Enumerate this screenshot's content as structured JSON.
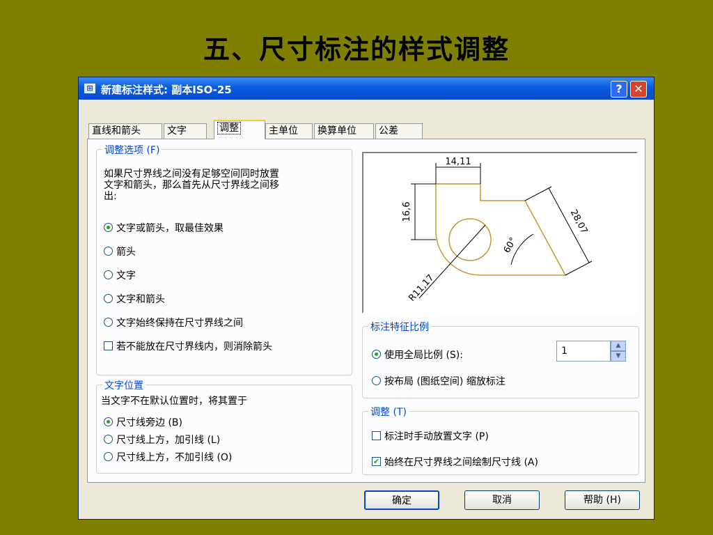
{
  "slide": {
    "title": "五、尺寸标注的样式调整"
  },
  "window": {
    "title": "新建标注样式: 副本ISO-25",
    "help": "?",
    "close": "✕"
  },
  "tabs": [
    {
      "label": "直线和箭头"
    },
    {
      "label": "文字"
    },
    {
      "label": "调整"
    },
    {
      "label": "主单位"
    },
    {
      "label": "换算单位"
    },
    {
      "label": "公差"
    }
  ],
  "fit_options": {
    "legend": "调整选项 (F)",
    "description_lines": [
      "如果尺寸界线之间没有足够空间同时放置",
      "文字和箭头，那么首先从尺寸界线之间移",
      "出:"
    ],
    "radios": [
      {
        "label": "文字或箭头，取最佳效果",
        "checked": true
      },
      {
        "label": "箭头",
        "checked": false
      },
      {
        "label": "文字",
        "checked": false
      },
      {
        "label": "文字和箭头",
        "checked": false
      },
      {
        "label": "文字始终保持在尺寸界线之间",
        "checked": false
      }
    ],
    "suppress_checkbox": {
      "label": "若不能放在尺寸界线内，则消除箭头",
      "checked": false
    }
  },
  "text_placement": {
    "legend": "文字位置",
    "description": "当文字不在默认位置时，将其置于",
    "radios": [
      {
        "label": "尺寸线旁边 (B)",
        "checked": true
      },
      {
        "label": "尺寸线上方，加引线 (L)",
        "checked": false
      },
      {
        "label": "尺寸线上方，不加引线 (O)",
        "checked": false
      }
    ]
  },
  "preview": {
    "dim_horizontal": "14,11",
    "dim_vertical": "16,6",
    "dim_aligned": "28,07",
    "dim_angle": "60°",
    "dim_radius": "R11,17"
  },
  "scale": {
    "legend": "标注特征比例",
    "use_overall": {
      "label": "使用全局比例 (S):",
      "checked": true
    },
    "scale_value": "1",
    "scale_to_layout": {
      "label": "按布局 (图纸空间) 缩放标注",
      "checked": false
    }
  },
  "fine_tuning": {
    "legend": "调整 (T)",
    "manual_place": {
      "label": "标注时手动放置文字 (P)",
      "checked": false
    },
    "always_draw": {
      "label": "始终在尺寸界线之间绘制尺寸线 (A)",
      "checked": true,
      "mark": "✔"
    }
  },
  "buttons": {
    "ok": "确定",
    "cancel": "取消",
    "help": "帮助 (H)"
  },
  "colors": {
    "background": "#808000",
    "titlebar": "#0a4ccd",
    "accent": "#0046d5",
    "preview_line": "#c89632"
  }
}
